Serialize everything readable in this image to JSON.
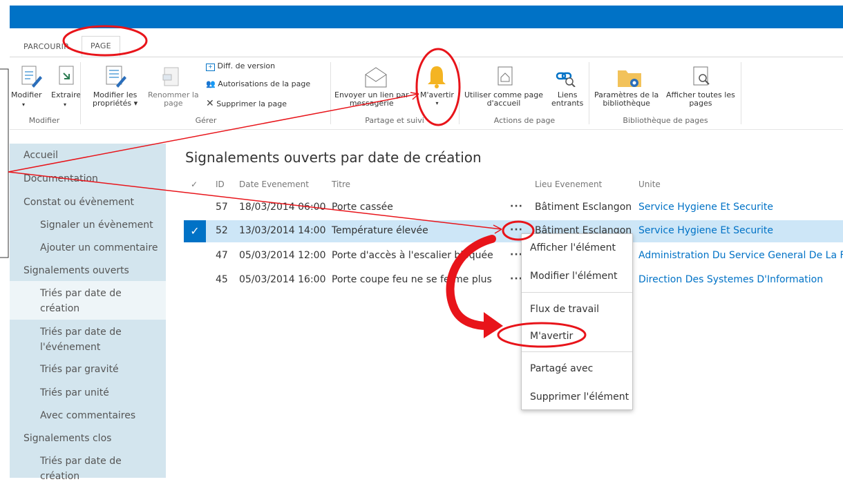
{
  "tabs": {
    "parcourir": "PARCOURIR",
    "page": "PAGE"
  },
  "ribbon": {
    "modifier": "Modifier",
    "extraire": "Extraire",
    "modifier_proprietes_1": "Modifier les",
    "modifier_proprietes_2": "propriétés",
    "renommer_1": "Renommer la",
    "renommer_2": "page",
    "diff_version": "Diff. de version",
    "autorisations": "Autorisations de la page",
    "supprimer_page": "Supprimer la page",
    "envoyer_lien_1": "Envoyer un lien par",
    "envoyer_lien_2": "messagerie",
    "m_avertir": "M'avertir",
    "utiliser_1": "Utiliser comme page",
    "utiliser_2": "d'accueil",
    "liens_1": "Liens",
    "liens_2": "entrants",
    "parametres_1": "Paramètres de la",
    "parametres_2": "bibliothèque",
    "afficher_1": "Afficher toutes les",
    "afficher_2": "pages",
    "groups": {
      "modifier": "Modifier",
      "gerer": "Gérer",
      "partage": "Partage et suivi",
      "actions": "Actions de page",
      "bibliotheque": "Bibliothèque de pages"
    }
  },
  "sidebar": {
    "accueil": "Accueil",
    "documentation": "Documentation",
    "constat": "Constat ou évènement",
    "signaler": "Signaler un évènement",
    "ajouter": "Ajouter un commentaire",
    "ouverts": "Signalements ouverts",
    "tries_creation_1": "Triés par date de",
    "tries_creation_2": "création",
    "tries_evenement_1": "Triés par date de",
    "tries_evenement_2": "l'événement",
    "tries_gravite": "Triés par gravité",
    "tries_unite": "Triés par unité",
    "avec_commentaires": "Avec commentaires",
    "clos": "Signalements clos",
    "clos_tries_1": "Triés par date de",
    "clos_tries_2": "création"
  },
  "main": {
    "title": "Signalements ouverts par date de création",
    "columns": {
      "check": "✓",
      "id": "ID",
      "date": "Date Evenement",
      "titre": "Titre",
      "lieu": "Lieu Evenement",
      "unite": "Unite"
    },
    "rows": [
      {
        "id": "57",
        "date": "18/03/2014 06:00",
        "titre": "Porte cassée",
        "lieu": "Bâtiment Esclangon",
        "unite": "Service Hygiene Et Securite"
      },
      {
        "id": "52",
        "date": "13/03/2014 14:00",
        "titre": "Température élevée",
        "lieu": "Bâtiment Esclangon",
        "unite": "Service Hygiene Et Securite"
      },
      {
        "id": "47",
        "date": "05/03/2014 12:00",
        "titre": "Porte d'accès à l'escalier bloquée",
        "lieu": "",
        "unite": "Administration Du Service General De La For"
      },
      {
        "id": "45",
        "date": "05/03/2014 16:00",
        "titre": "Porte coupe feu ne se ferme plus",
        "lieu": "",
        "unite": "Direction Des Systemes D'Information"
      }
    ],
    "ellipsis": "···"
  },
  "context_menu": {
    "afficher": "Afficher l'élément",
    "modifier": "Modifier l'élément",
    "flux": "Flux de travail",
    "m_avertir": "M'avertir",
    "partage": "Partagé avec",
    "supprimer": "Supprimer l'élément"
  },
  "colors": {
    "brand": "#0072c6",
    "nav_bg": "#d3e5ee",
    "annotation": "#e8141a",
    "selected_row": "#cde6f7"
  }
}
